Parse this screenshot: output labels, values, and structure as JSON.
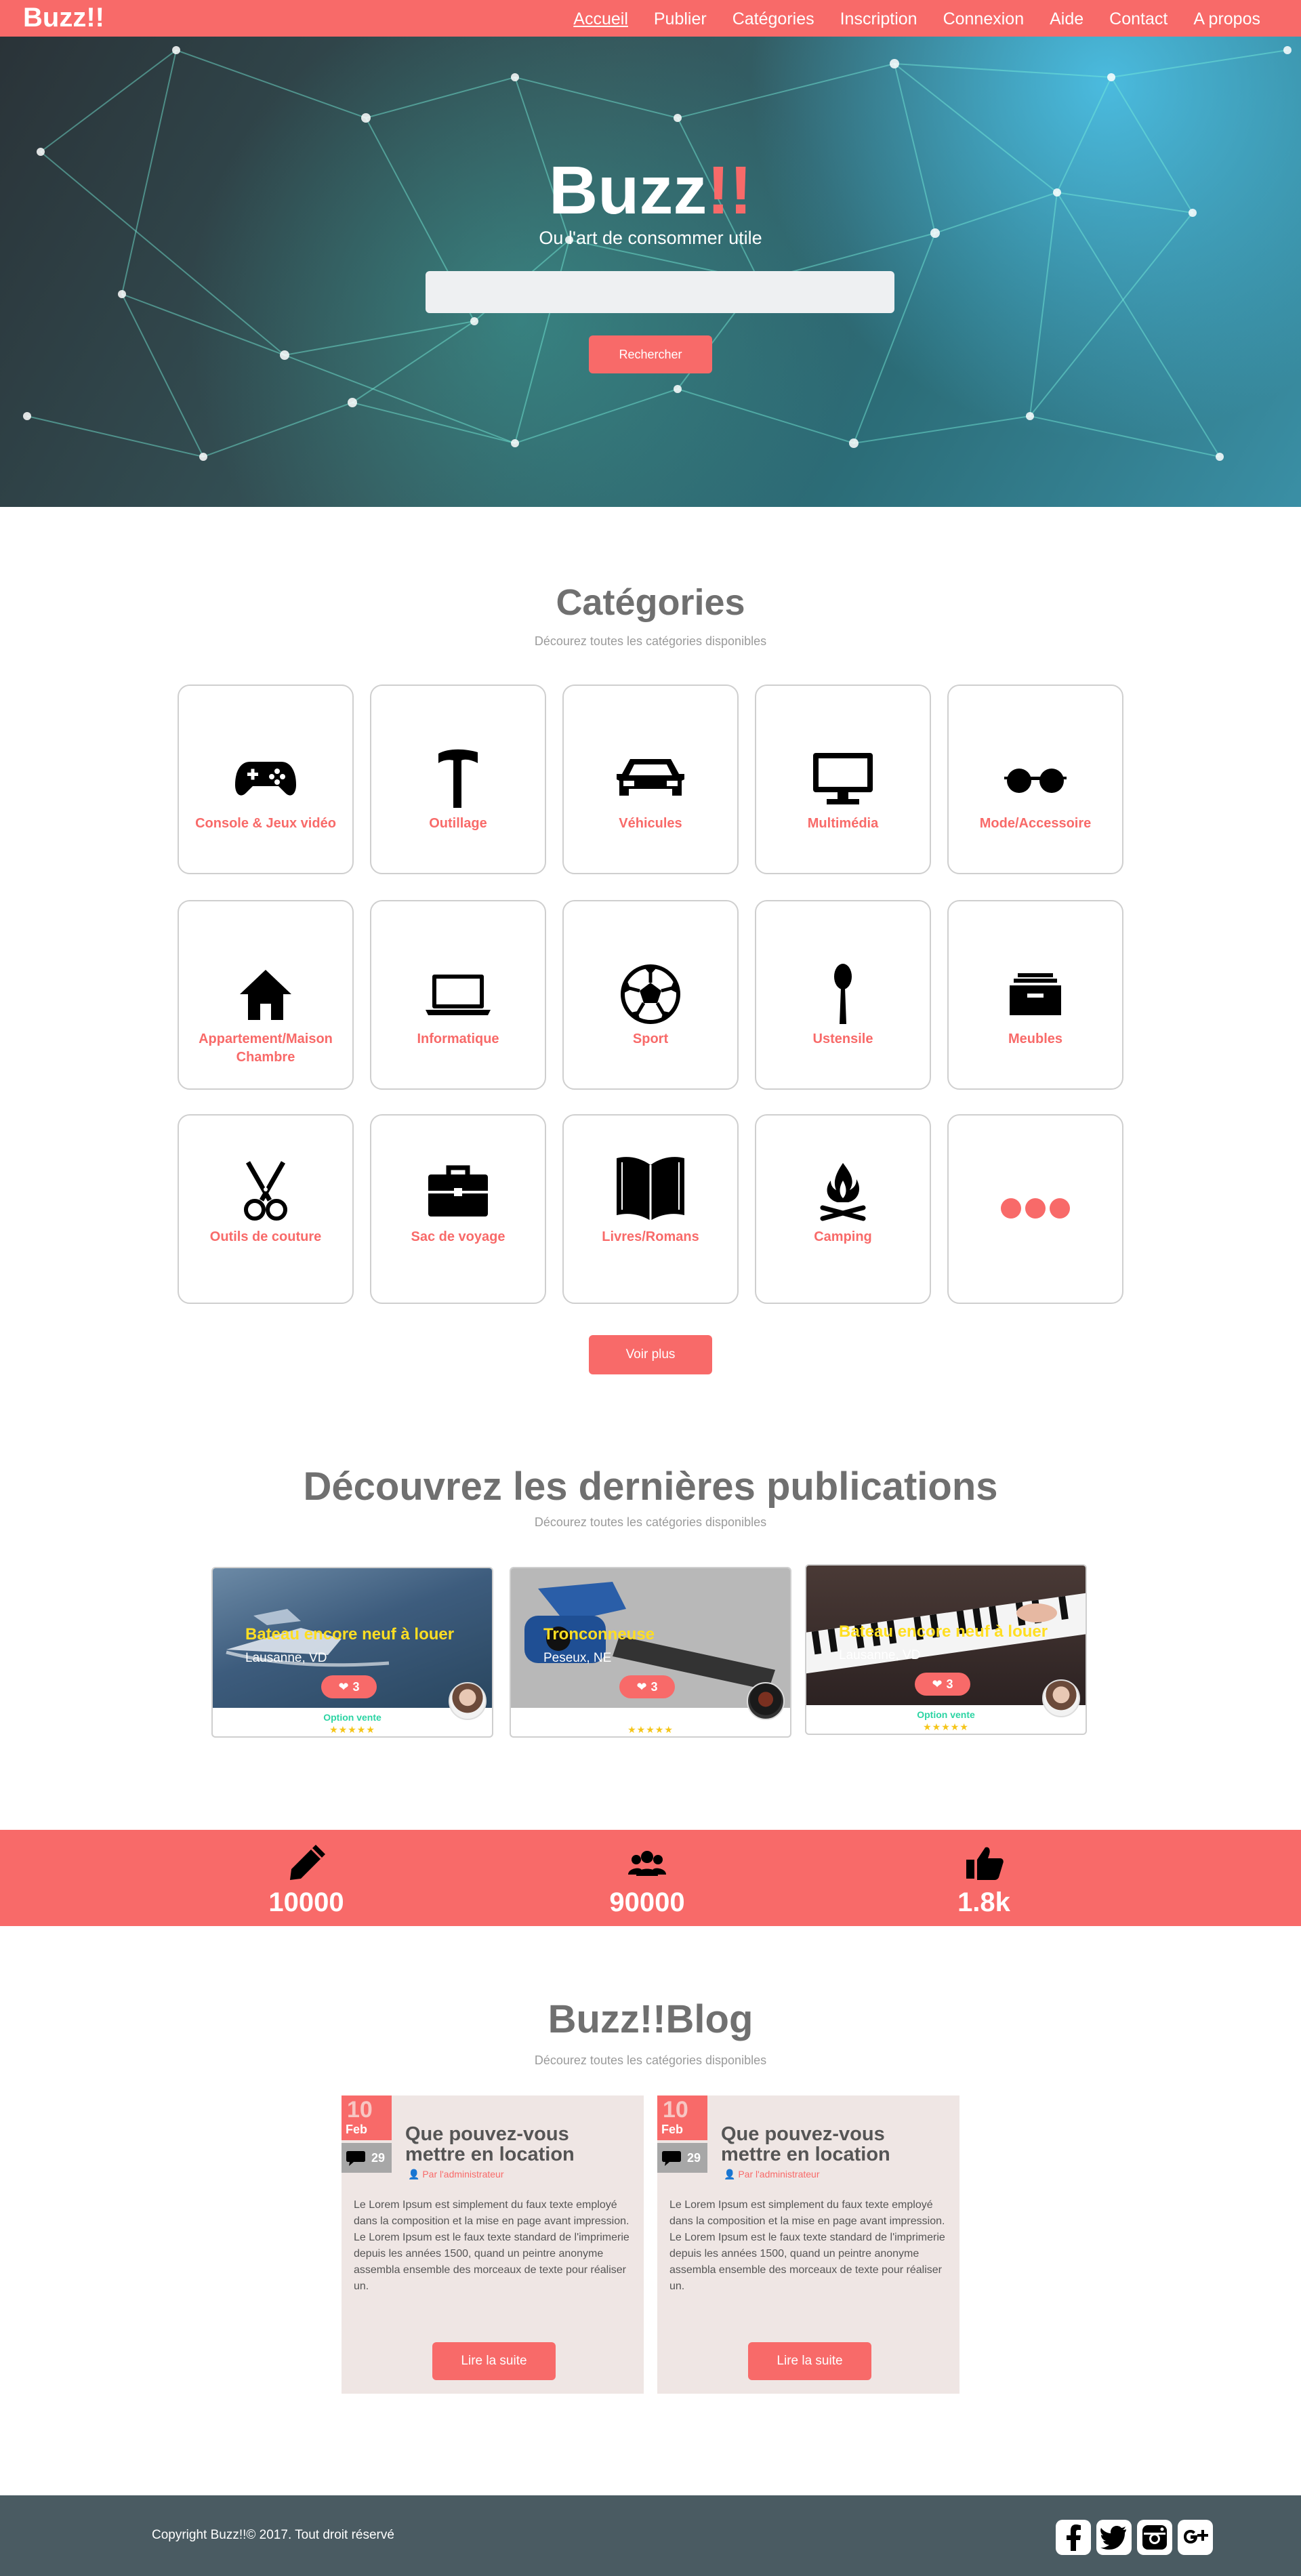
{
  "nav": {
    "brand": "Buzz!!",
    "links": [
      "Accueil",
      "Publier",
      "Catégories",
      "Inscription",
      "Connexion",
      "Aide",
      "Contact",
      "A propos"
    ]
  },
  "hero": {
    "title_main": "Buzz",
    "title_bang": "!!",
    "subtitle": "Ou l'art de consommer utile",
    "search_placeholder": "",
    "search_button": "Rechercher"
  },
  "categories": {
    "title": "Catégories",
    "subtitle": "Décourez toutes les catégories disponibles",
    "items": [
      {
        "label": "Console & Jeux vidéo",
        "icon": "gamepad-icon"
      },
      {
        "label": "Outillage",
        "icon": "hammer-icon"
      },
      {
        "label": "Véhicules",
        "icon": "car-icon"
      },
      {
        "label": "Multimédia",
        "icon": "monitor-icon"
      },
      {
        "label": "Mode/Accessoire",
        "icon": "glasses-icon"
      },
      {
        "label": "Appartement/Maison Chambre",
        "icon": "house-icon"
      },
      {
        "label": "Informatique",
        "icon": "laptop-icon"
      },
      {
        "label": "Sport",
        "icon": "soccer-ball-icon"
      },
      {
        "label": "Ustensile",
        "icon": "spoon-icon"
      },
      {
        "label": "Meubles",
        "icon": "drawer-icon"
      },
      {
        "label": "Outils de couture",
        "icon": "scissors-icon"
      },
      {
        "label": "Sac de voyage",
        "icon": "briefcase-icon"
      },
      {
        "label": "Livres/Romans",
        "icon": "book-icon"
      },
      {
        "label": "Camping",
        "icon": "campfire-icon"
      },
      {
        "label": "",
        "icon": "more-dots-icon"
      }
    ],
    "more_button": "Voir plus"
  },
  "publications": {
    "title": "Découvrez les dernières publications",
    "subtitle": "Décourez toutes les catégories disponibles",
    "items": [
      {
        "title": "Bateau encore neuf à louer",
        "location": "Lausanne, VD",
        "likes": "3",
        "option": "Option vente",
        "stars": "★★★★★"
      },
      {
        "title": "Tronconneuse",
        "location": "Peseux, NE",
        "likes": "3",
        "option": "",
        "stars": "★★★★★"
      },
      {
        "title": "Bateau encore neuf à louer",
        "location": "Lausanne, VD",
        "likes": "3",
        "option": "Option vente",
        "stars": "★★★★★"
      }
    ]
  },
  "stats": [
    {
      "value": "10000",
      "icon": "pencil-icon"
    },
    {
      "value": "90000",
      "icon": "users-icon"
    },
    {
      "value": "1.8k",
      "icon": "thumbs-up-icon"
    }
  ],
  "blog": {
    "title": "Buzz!!Blog",
    "subtitle": "Décourez toutes les catégories disponibles",
    "posts": [
      {
        "day": "10",
        "month": "Feb",
        "comments": "29",
        "title": "Que pouvez-vous mettre en location",
        "author": "Par l'administrateur",
        "text": "Le Lorem Ipsum est simplement du faux texte employé dans la composition et la mise en page avant impression. Le Lorem Ipsum est le faux texte standard de l'imprimerie depuis les années 1500, quand un peintre anonyme assembla ensemble des morceaux de texte pour réaliser un.",
        "button": "Lire la suite"
      },
      {
        "day": "10",
        "month": "Feb",
        "comments": "29",
        "title": "Que pouvez-vous mettre en location",
        "author": "Par l'administrateur",
        "text": "Le Lorem Ipsum est simplement du faux texte employé dans la composition et la mise en page avant impression. Le Lorem Ipsum est le faux texte standard de l'imprimerie depuis les années 1500, quand un peintre anonyme assembla ensemble des morceaux de texte pour réaliser un.",
        "button": "Lire la suite"
      }
    ]
  },
  "footer": {
    "copyright": "Copyright Buzz!!© 2017. Tout droit réservé",
    "social": [
      "facebook-icon",
      "twitter-icon",
      "instagram-icon",
      "google-plus-icon"
    ]
  },
  "colors": {
    "accent": "#f86a69",
    "footer": "#4a5b62",
    "heading": "#707070",
    "title_yellow": "#ffde22"
  }
}
